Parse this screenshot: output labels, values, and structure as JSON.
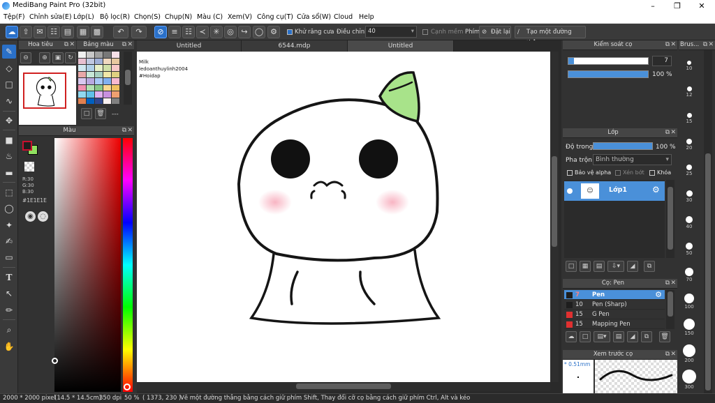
{
  "window": {
    "title": "MediBang Paint Pro (32bit)"
  },
  "menu": [
    "Tệp(F)",
    "Chỉnh sửa(E)",
    "Lớp(L)",
    "Bộ lọc(R)",
    "Chọn(S)",
    "Chụp(N)",
    "Màu (C)",
    "Xem(V)",
    "Công cụ(T)",
    "Cửa sổ(W)",
    "Cloud",
    "Help"
  ],
  "toolbar": {
    "antialias_label": "Khử răng cưa",
    "adjust_label": "Điều chỉnh",
    "adjust_value": "40",
    "smooth_edge_label": "Cạnh mềm",
    "key_label": "Phím",
    "reset_label": "Đặt lại",
    "create_line_label": "Tạo một đường thẳng"
  },
  "navigator": {
    "title": "Hoa tiêu"
  },
  "palette": {
    "title": "Bảng màu",
    "extra": "---"
  },
  "color": {
    "title": "Màu",
    "r": "R:30",
    "g": "G:30",
    "b": "B:30",
    "hex": "#1E1E1E",
    "fg": "#c8102e",
    "bg": "#90e060"
  },
  "canvas_tabs": [
    "Untitled",
    "6544.mdp",
    "Untitled"
  ],
  "canvas_text": [
    "Milk",
    "ledoanthuylinh2004",
    "#Hoidap"
  ],
  "brush_control": {
    "title": "Kiểm soát cọ",
    "size": "7",
    "opacity": "100 %",
    "size_fraction": 0.07,
    "opacity_fraction": 1.0
  },
  "layer": {
    "title": "Lớp",
    "opacity_label": "Độ trong",
    "opacity_value": "100 %",
    "opacity_fraction": 1.0,
    "blend_label": "Pha trộn",
    "blend_value": "Bình thường",
    "protect_alpha": "Bảo vệ alpha",
    "clipping": "Xén bớt",
    "lock": "Khóa",
    "layers": [
      {
        "name": "Lớp1"
      }
    ]
  },
  "brush": {
    "title": "Cọ: Pen",
    "items": [
      {
        "size": "7",
        "name": "Pen",
        "color": "#1e1e1e",
        "selected": true
      },
      {
        "size": "10",
        "name": "Pen (Sharp)",
        "color": "#1e1e1e",
        "selected": false
      },
      {
        "size": "15",
        "name": "G Pen",
        "color": "#e03030",
        "selected": false
      },
      {
        "size": "15",
        "name": "Mapping Pen",
        "color": "#e03030",
        "selected": false
      }
    ]
  },
  "preview": {
    "title": "Xem trước cọ",
    "size": "* 0.51mm"
  },
  "brush_sizes": {
    "title": "Brus...",
    "sizes": [
      "10",
      "12",
      "15",
      "20",
      "25",
      "30",
      "40",
      "50",
      "70",
      "100",
      "150",
      "200",
      "300"
    ]
  },
  "status": {
    "size": "2000 * 2000 pixel",
    "cm": "(14.5 * 14.5cm)",
    "dpi": "350 dpi",
    "zoom": "50 %",
    "coord": "( 1373, 230 )",
    "hint": "Vẽ một đường thẳng bằng cách giữ phím Shift, Thay đổi cỡ cọ bằng cách giữ phím Ctrl, Alt và kéo"
  }
}
